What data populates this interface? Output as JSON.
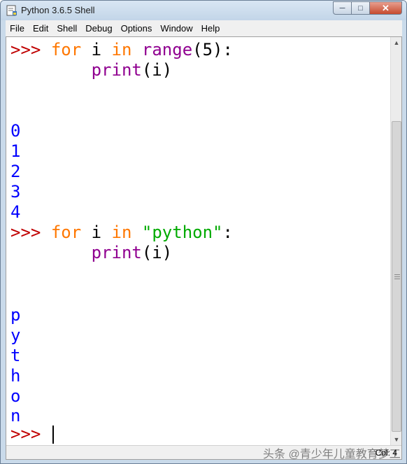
{
  "window": {
    "title": "Python 3.6.5 Shell",
    "controls": {
      "minimize": "─",
      "maximize": "□",
      "close": "✕"
    }
  },
  "menu": [
    {
      "label": "File"
    },
    {
      "label": "Edit"
    },
    {
      "label": "Shell"
    },
    {
      "label": "Debug"
    },
    {
      "label": "Options"
    },
    {
      "label": "Window"
    },
    {
      "label": "Help"
    }
  ],
  "editor": {
    "prompt": ">>>",
    "block1": {
      "kw_for": "for",
      "var": "i",
      "kw_in": "in",
      "func": "range",
      "args": "(5):",
      "indent": "    ",
      "print": "print",
      "print_args": "(i)"
    },
    "output1": [
      "0",
      "1",
      "2",
      "3",
      "4"
    ],
    "block2": {
      "kw_for": "for",
      "var": "i",
      "kw_in": "in",
      "string": "\"python\"",
      "colon": ":",
      "indent": "    ",
      "print": "print",
      "print_args": "(i)"
    },
    "output2": [
      "p",
      "y",
      "t",
      "h",
      "o",
      "n"
    ]
  },
  "status": {
    "col": "Col: 4"
  },
  "watermark": "头条 @青少年儿童教育梦工厂",
  "colors": {
    "prompt": "#c00000",
    "keyword": "#ff7700",
    "builtin": "#900090",
    "string": "#00aa00",
    "output": "#0000ff"
  }
}
